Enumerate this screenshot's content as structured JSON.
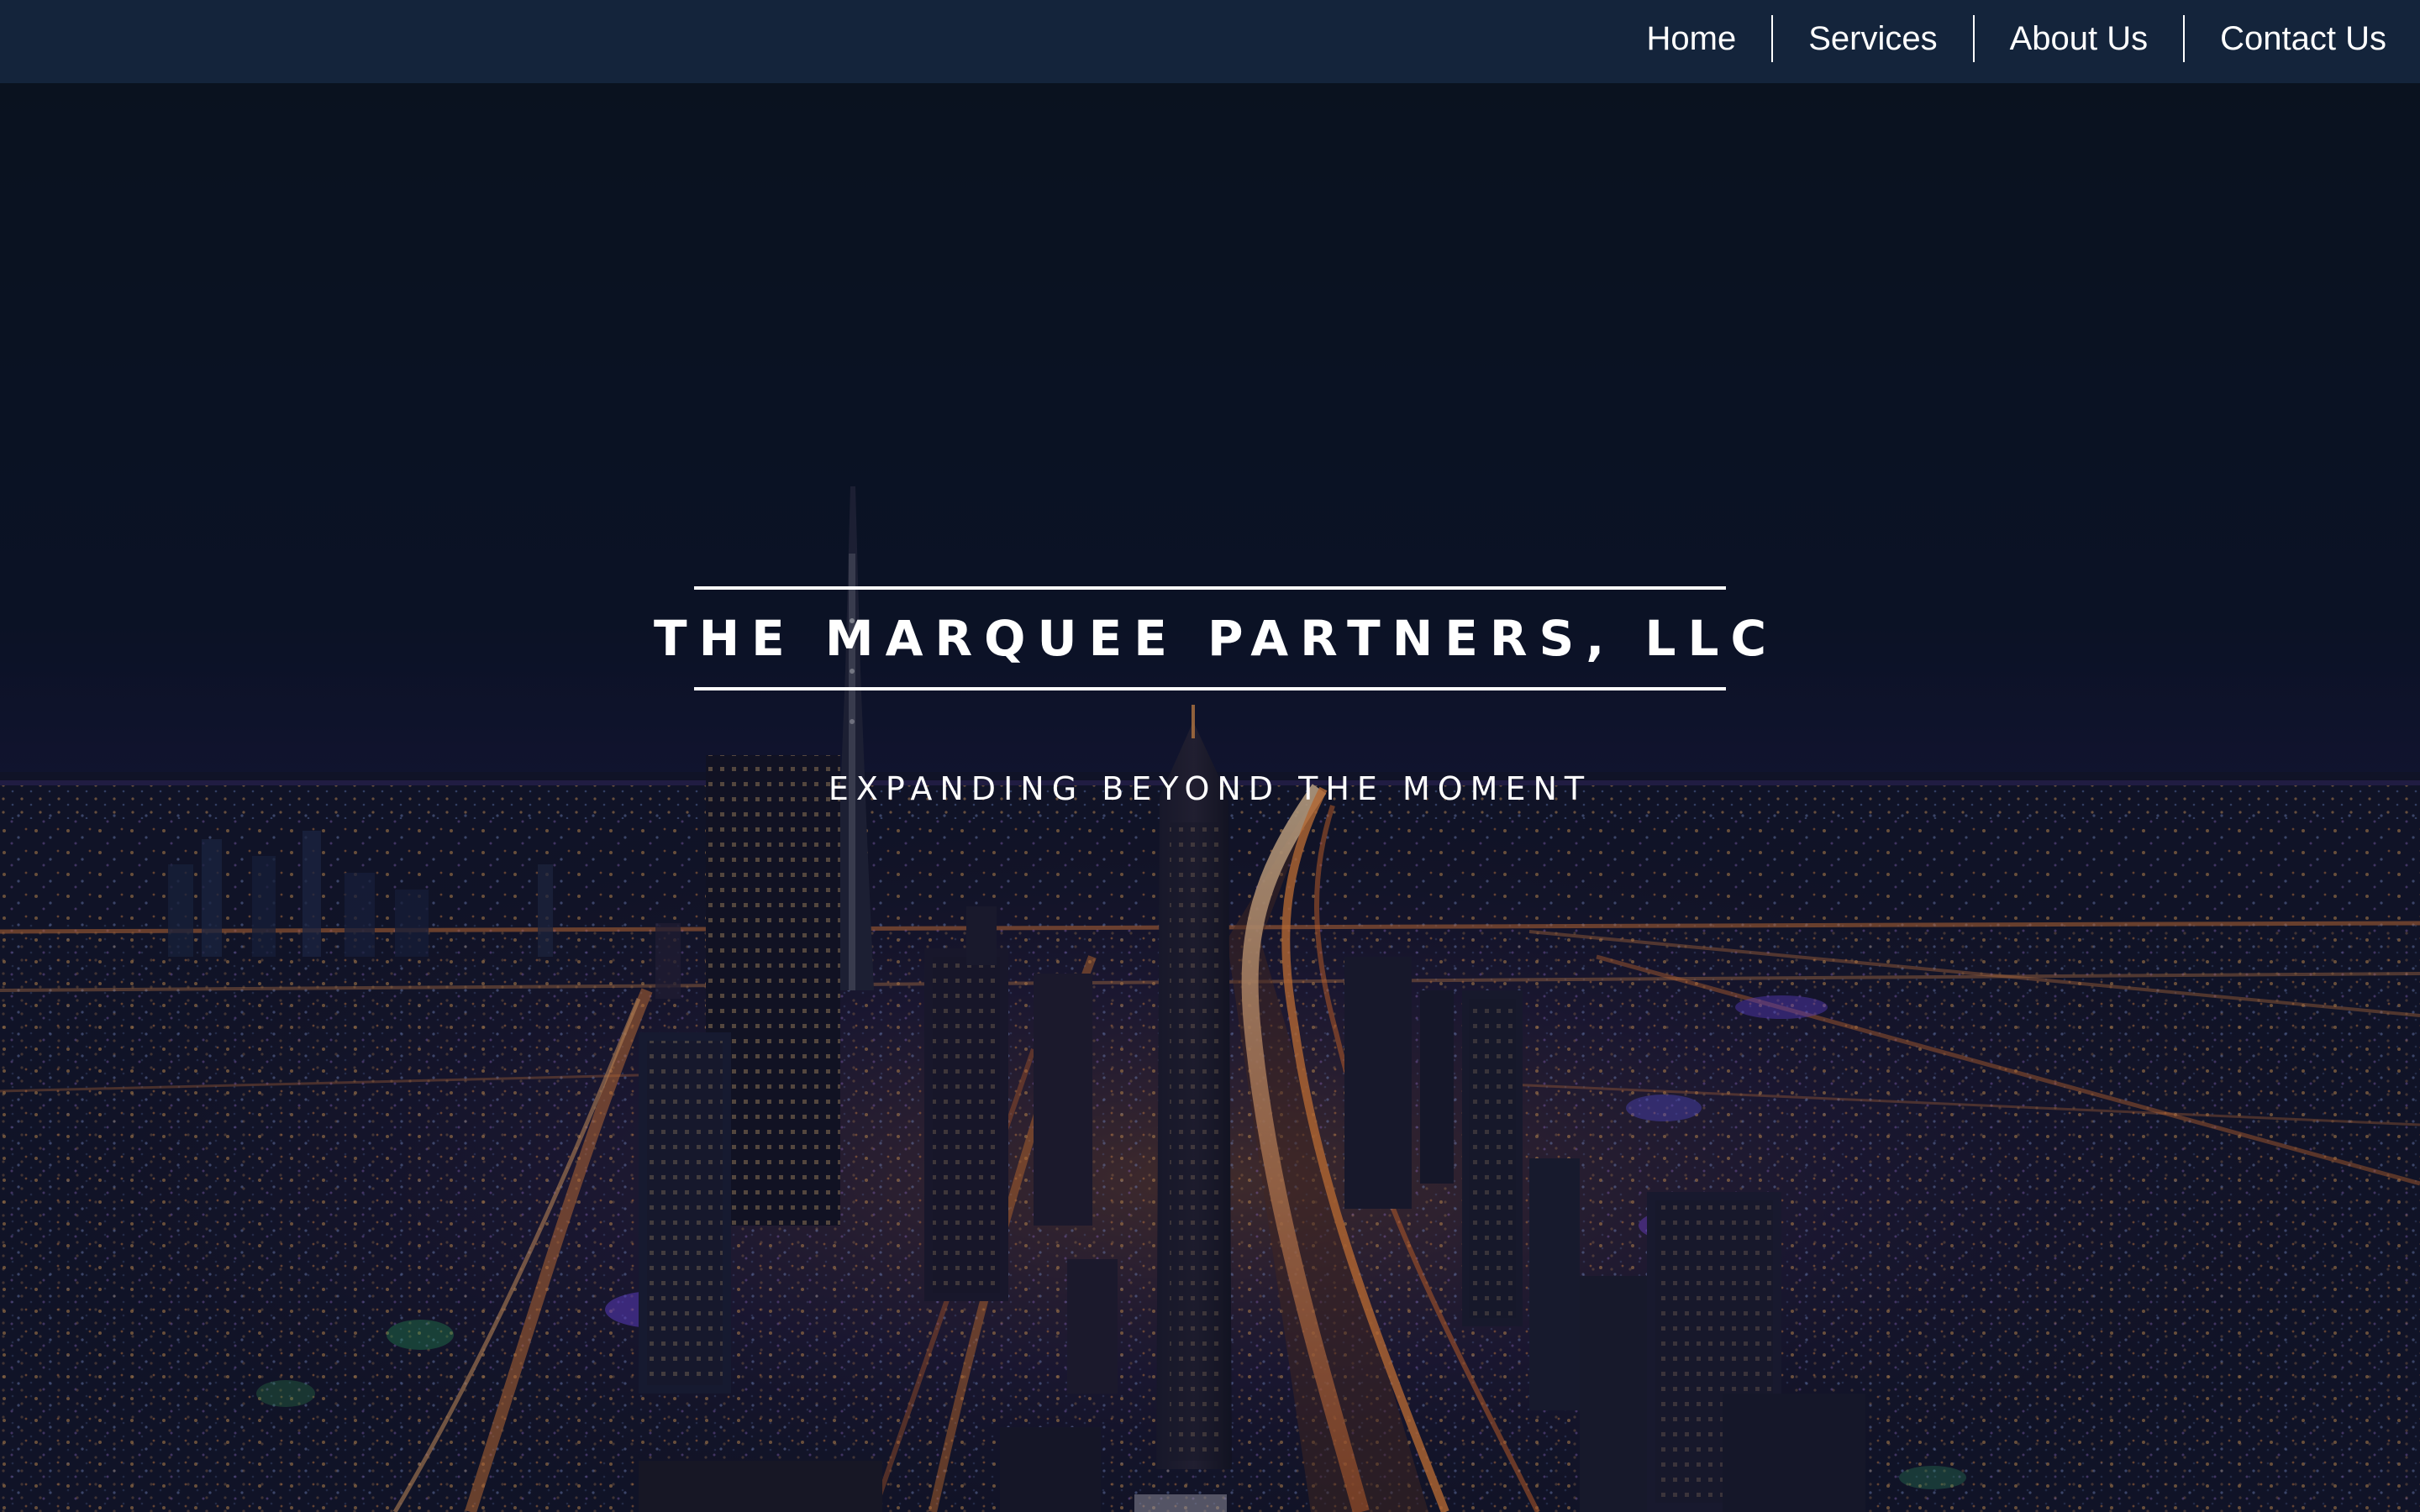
{
  "nav": {
    "items": [
      {
        "label": "Home"
      },
      {
        "label": "Services"
      },
      {
        "label": "About Us"
      },
      {
        "label": "Contact Us"
      }
    ]
  },
  "hero": {
    "title": "THE MARQUEE PARTNERS, LLC",
    "tagline": "EXPANDING BEYOND THE MOMENT",
    "background": "night-city-skyline-photo"
  },
  "colors": {
    "navbar": "#14243b",
    "sky": "#0a121e",
    "text": "#ffffff",
    "city_light_orange": "#ff9a3c",
    "city_light_violet": "#7c4dff"
  }
}
